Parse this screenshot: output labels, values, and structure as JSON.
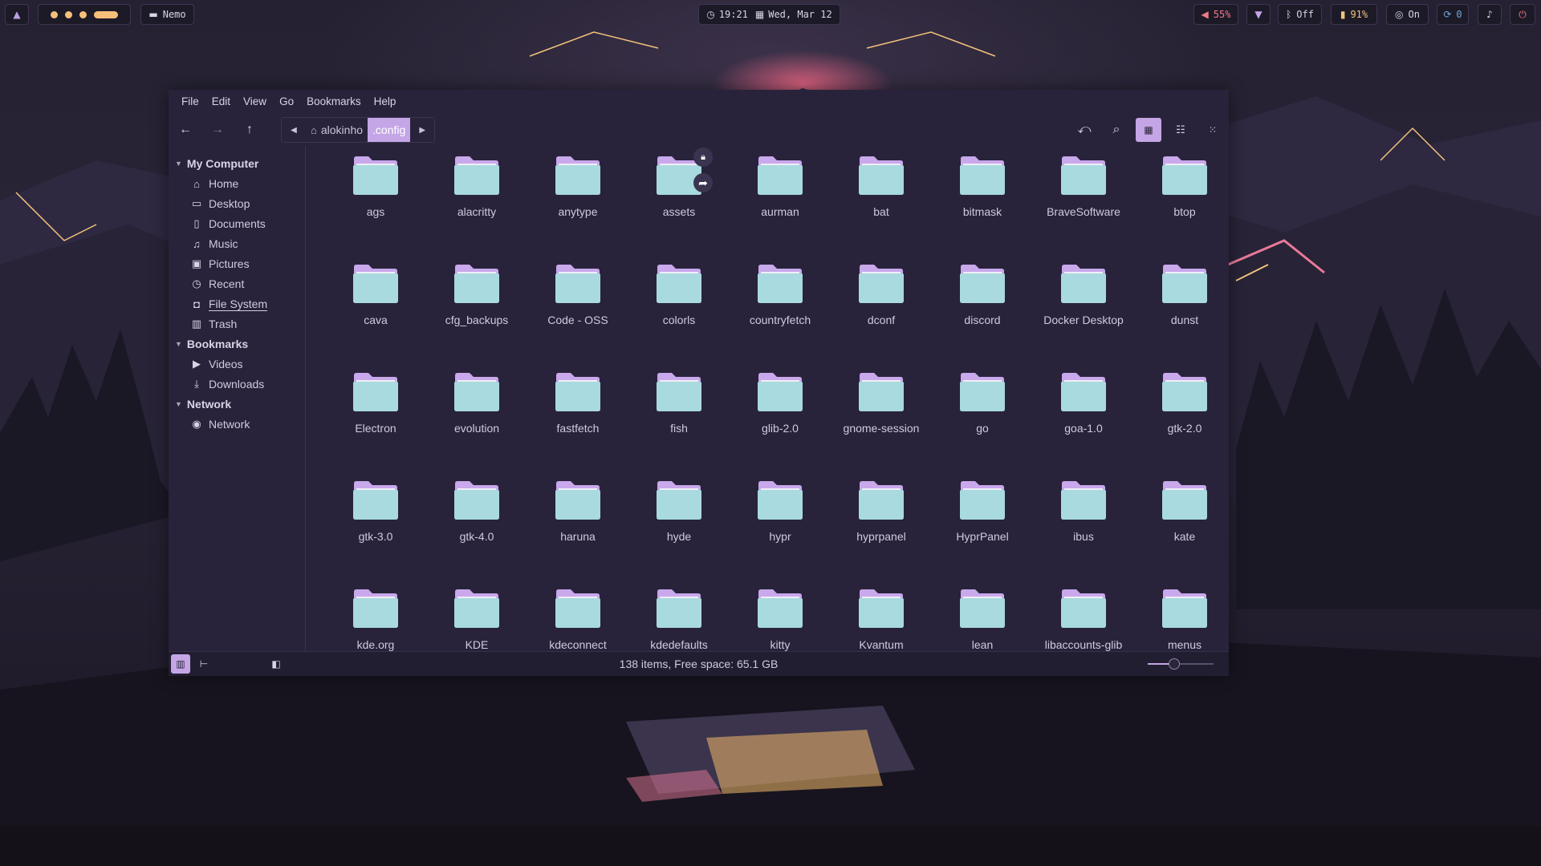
{
  "topbar": {
    "workspace_count": 3,
    "app_icon": "folder-icon",
    "app_name": "Nemo",
    "time": "19:21",
    "date": "Wed, Mar 12",
    "volume": "55%",
    "bluetooth": "Off",
    "battery": "91%",
    "idle_inhibit": "On",
    "updates": "0"
  },
  "window": {
    "menus": [
      "File",
      "Edit",
      "View",
      "Go",
      "Bookmarks",
      "Help"
    ],
    "breadcrumb": {
      "home": "alokinho",
      "current": ".config"
    },
    "sidebar": {
      "sections": [
        {
          "title": "My Computer",
          "items": [
            {
              "label": "Home",
              "icon": "home-icon"
            },
            {
              "label": "Desktop",
              "icon": "desktop-icon"
            },
            {
              "label": "Documents",
              "icon": "document-icon"
            },
            {
              "label": "Music",
              "icon": "music-icon"
            },
            {
              "label": "Pictures",
              "icon": "picture-icon"
            },
            {
              "label": "Recent",
              "icon": "clock-icon"
            },
            {
              "label": "File System",
              "icon": "drive-icon"
            },
            {
              "label": "Trash",
              "icon": "trash-icon"
            }
          ]
        },
        {
          "title": "Bookmarks",
          "items": [
            {
              "label": "Videos",
              "icon": "video-icon"
            },
            {
              "label": "Downloads",
              "icon": "download-icon"
            }
          ]
        },
        {
          "title": "Network",
          "items": [
            {
              "label": "Network",
              "icon": "globe-icon"
            }
          ]
        }
      ]
    },
    "files": [
      "ags",
      "alacritty",
      "anytype",
      "assets",
      "aurman",
      "bat",
      "bitmask",
      "BraveSoftware",
      "btop",
      "cava",
      "cfg_backups",
      "Code - OSS",
      "colorls",
      "countryfetch",
      "dconf",
      "discord",
      "Docker Desktop",
      "dunst",
      "Electron",
      "evolution",
      "fastfetch",
      "fish",
      "glib-2.0",
      "gnome-session",
      "go",
      "goa-1.0",
      "gtk-2.0",
      "gtk-3.0",
      "gtk-4.0",
      "haruna",
      "hyde",
      "hypr",
      "hyprpanel",
      "HyprPanel",
      "ibus",
      "kate",
      "kde.org",
      "KDE",
      "kdeconnect",
      "kdedefaults",
      "kitty",
      "Kvantum",
      "lean",
      "libaccounts-glib",
      "menus"
    ],
    "status": "138 items, Free space: 65.1 GB",
    "zoom_level": 0.4,
    "colors": {
      "accent": "#c4a6e6",
      "folder": "#a8dadf",
      "folder_tab": "#c9a8ec"
    }
  }
}
